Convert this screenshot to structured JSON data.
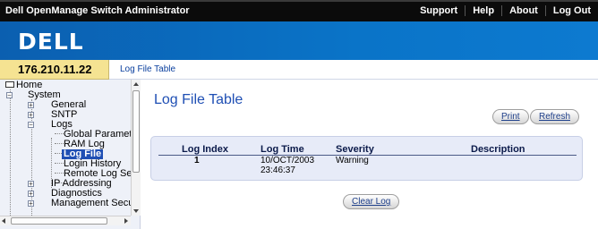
{
  "app": {
    "title": "Dell OpenManage Switch Administrator",
    "top_links": [
      "Support",
      "Help",
      "About",
      "Log Out"
    ],
    "logo_text": "DELL"
  },
  "address": {
    "ip": "176.210.11.22"
  },
  "breadcrumb": {
    "current": "Log File Table"
  },
  "tree": {
    "home": "Home",
    "system": "System",
    "general": "General",
    "sntp": "SNTP",
    "logs": "Logs",
    "global_parameters": "Global Parameter",
    "ram_log": "RAM Log",
    "log_file": "Log File",
    "login_history": "Login History",
    "remote_log_server": "Remote Log Serv",
    "ip_addressing": "IP Addressing",
    "diagnostics": "Diagnostics",
    "management_security": "Management Securit"
  },
  "main": {
    "title": "Log File Table",
    "print_label": "Print",
    "refresh_label": "Refresh",
    "clear_log_label": "Clear Log"
  },
  "table": {
    "headers": {
      "index": "Log Index",
      "time": "Log Time",
      "severity": "Severity",
      "description": "Description"
    },
    "rows": [
      {
        "index": "1",
        "time_date": "10/OCT/2003",
        "time_clock": "23:46:37",
        "severity": "Warning",
        "description": ""
      }
    ]
  },
  "colors": {
    "top_bar": "#0b0b0b",
    "brand_band": "#0a74c8",
    "ip_strip": "#f5e392",
    "title_blue": "#1f4fb4",
    "table_bg": "#e7ebf8",
    "selected_node": "#1f4fb4"
  },
  "icons": {
    "home": "home-icon",
    "expand": "plus-toggle-icon",
    "collapse": "minus-toggle-icon"
  }
}
